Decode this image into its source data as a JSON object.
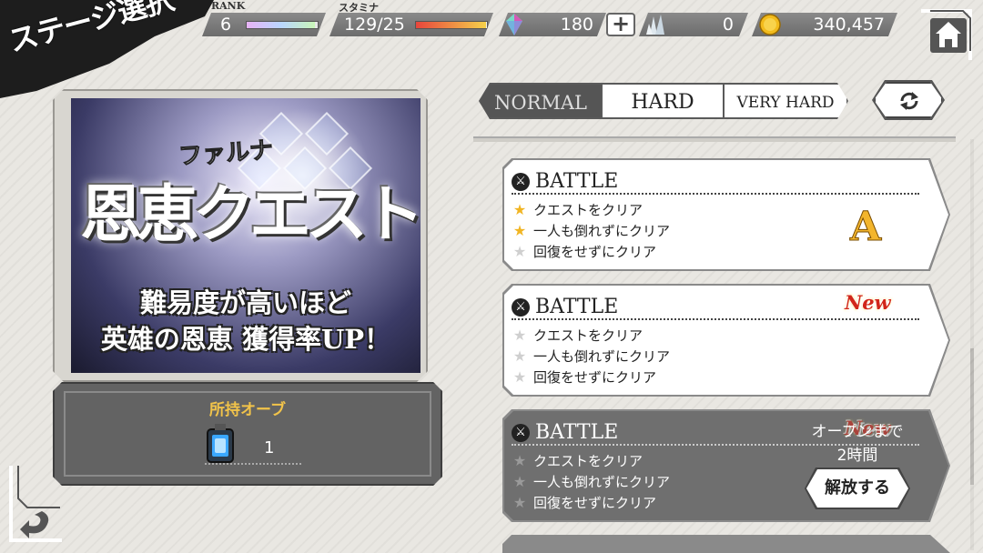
{
  "screen": {
    "title": "ステージ選択"
  },
  "status": {
    "rank_label": "RANK",
    "rank_value": "6",
    "rank_progress": 0.96,
    "stamina_label": "スタミナ",
    "stamina_value": "129/25",
    "stamina_progress": 0.99,
    "crystal_value": "180",
    "plus_label": "+",
    "shard_value": "0",
    "gold_value": "340,457"
  },
  "banner": {
    "subtitle": "ファルナ",
    "title": "恩恵クエスト",
    "line1": "難易度が高いほど",
    "line2": "英雄の恩恵 獲得率UP！"
  },
  "orbs": {
    "title": "所持オーブ",
    "count": "1"
  },
  "tabs": {
    "normal": "NORMAL",
    "hard": "HARD",
    "very_hard": "VERY HARD",
    "selected": "NORMAL"
  },
  "quests": [
    {
      "label": "BATTLE",
      "conditions": [
        "クエストをクリア",
        "一人も倒れずにクリア",
        "回復をせずにクリア"
      ],
      "stars": [
        true,
        true,
        false
      ],
      "rank": "A",
      "is_new": false,
      "locked": false
    },
    {
      "label": "BATTLE",
      "conditions": [
        "クエストをクリア",
        "一人も倒れずにクリア",
        "回復をせずにクリア"
      ],
      "stars": [
        false,
        false,
        false
      ],
      "rank": "",
      "is_new": true,
      "new_label": "New",
      "locked": false
    },
    {
      "label": "BATTLE",
      "conditions": [
        "クエストをクリア",
        "一人も倒れずにクリア",
        "回復をせずにクリア"
      ],
      "stars": [
        false,
        false,
        false
      ],
      "rank": "",
      "is_new": true,
      "new_label": "New",
      "locked": true,
      "open_text_1": "オープンまで",
      "open_text_2": "2時間",
      "unlock_label": "解放する"
    }
  ],
  "colors": {
    "star_on": "#f1b523",
    "rank_gold": "#f3b52c",
    "new_red": "#d1261a",
    "orb_title": "#f1c34a"
  }
}
